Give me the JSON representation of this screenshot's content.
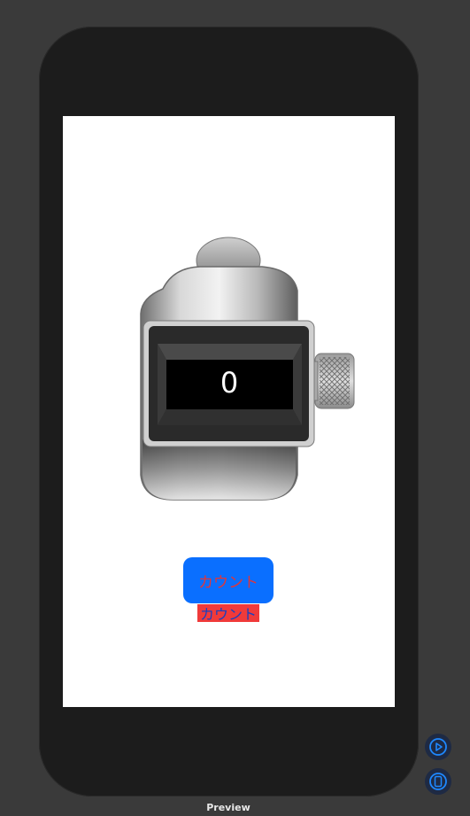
{
  "app": {
    "counter_value": "0",
    "count_button_label": "カウント",
    "count_label_text": "カウント"
  },
  "preview": {
    "label": "Preview",
    "controls": [
      {
        "name": "live-preview",
        "icon": "play-circle-icon"
      },
      {
        "name": "device-settings",
        "icon": "device-icon"
      }
    ]
  },
  "colors": {
    "background": "#3a3a3a",
    "device": "#1c1c1c",
    "screen": "#ffffff",
    "button": "#0a6fff",
    "button_text": "#e0363a",
    "label_bg": "#f03a3a",
    "label_text": "#1a40c0",
    "control_accent": "#1e88ff"
  }
}
